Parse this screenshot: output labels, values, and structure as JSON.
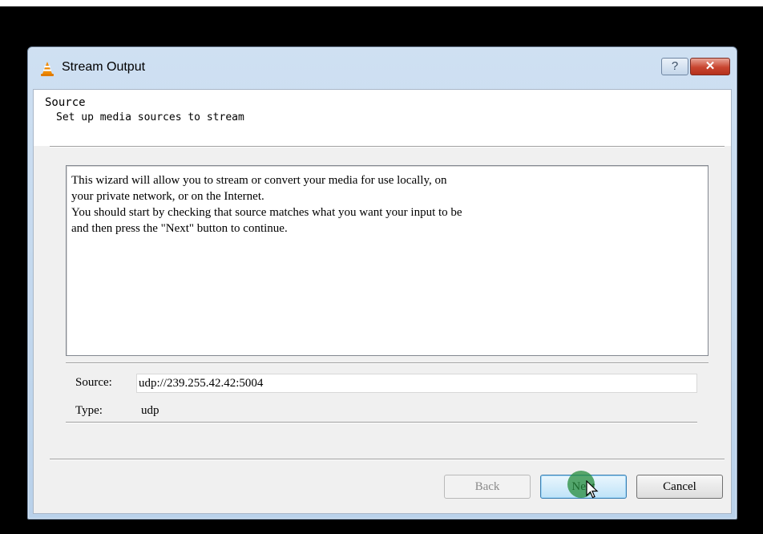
{
  "window": {
    "title": "Stream Output",
    "help_glyph": "?",
    "close_glyph": "✕"
  },
  "header": {
    "title": "Source",
    "subtitle": "Set up media sources to stream"
  },
  "intro": {
    "lines": [
      "This wizard will allow you to stream or convert your media for use locally, on",
      "your private network, or on the Internet.",
      "You should start by checking that source matches what you want your input to be",
      "and then press the \"Next\" button to continue."
    ]
  },
  "fields": {
    "source_label": "Source:",
    "source_value": "udp://239.255.42.42:5004",
    "type_label": "Type:",
    "type_value": "udp"
  },
  "buttons": {
    "back": "Back",
    "next": "Next",
    "cancel": "Cancel"
  },
  "icons": {
    "app": "vlc-cone-icon",
    "help": "help-icon",
    "close": "close-icon",
    "cursor": "mouse-pointer-icon"
  },
  "colors": {
    "vlc_orange": "#f08a00",
    "close_red": "#c8452f",
    "click_highlight": "#268c3c"
  }
}
